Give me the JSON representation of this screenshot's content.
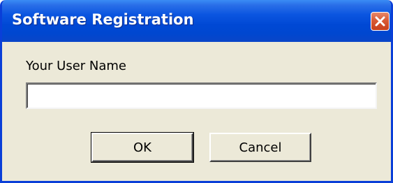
{
  "window": {
    "title": "Software Registration",
    "close_icon": "close-icon"
  },
  "form": {
    "user_name_label": "Your User Name",
    "user_name_value": "",
    "user_name_placeholder": ""
  },
  "buttons": {
    "ok_label": "OK",
    "cancel_label": "Cancel"
  },
  "colors": {
    "titlebar_blue": "#0048d4",
    "dialog_background": "#ece9d8",
    "close_button_red": "#d95a34"
  }
}
